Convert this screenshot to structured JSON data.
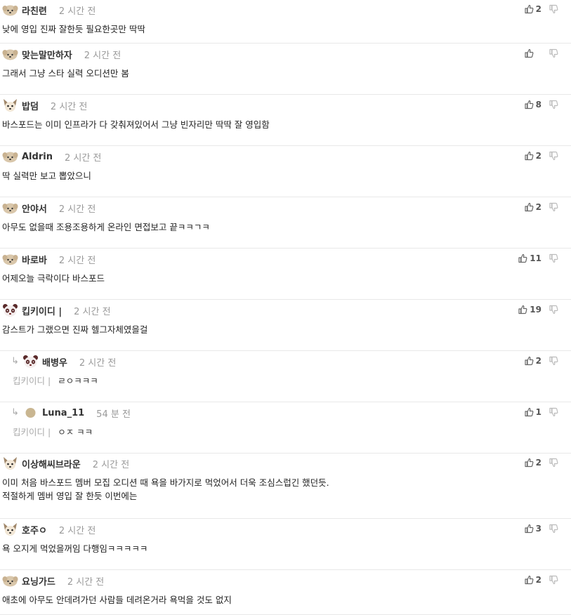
{
  "comments": [
    {
      "nick": "라친련",
      "time": "2 시간 전",
      "text": "낮에 영입 진짜 잘한듯 필요한곳만 딱딱",
      "votes": "2",
      "avatar": "pup"
    },
    {
      "nick": "맞는말만하자",
      "time": "2 시간 전",
      "text": "그래서 그냥 스타 실력 오디션만 봄",
      "votes": "",
      "avatar": "pup"
    },
    {
      "nick": "밥덤",
      "time": "2 시간 전",
      "text": "바스포드는 이미 인프라가 다 갖춰져있어서 그냥 빈자리만 딱딱 잘 영입함",
      "votes": "8",
      "avatar": "fox"
    },
    {
      "nick": "Aldrin",
      "time": "2 시간 전",
      "text": "딱 실력만 보고 뽑았으니",
      "votes": "2",
      "avatar": "pup"
    },
    {
      "nick": "안야서",
      "time": "2 시간 전",
      "text": "아무도 없을때 조용조용하게 온라인 면접보고 끝ㅋㅋㄱㅋ",
      "votes": "2",
      "avatar": "pup"
    },
    {
      "nick": "바로바",
      "time": "2 시간 전",
      "text": "어제오늘 극락이다 바스포드",
      "votes": "11",
      "avatar": "pup"
    },
    {
      "nick": "킵키이디 |",
      "time": "2 시간 전",
      "text": "감스트가 그랬으면 진짜 헬그자체였을걸",
      "votes": "19",
      "avatar": "panda"
    },
    {
      "nick": "배병우",
      "time": "2 시간 전",
      "mention": "킵키이디 |",
      "text": "ㄹㅇㅋㅋㅋ",
      "votes": "2",
      "avatar": "panda",
      "reply": true
    },
    {
      "nick": "Luna_11",
      "time": "54 분 전",
      "mention": "킵키이디 |",
      "text": "ㅇㅈ ㅋㅋ",
      "votes": "1",
      "avatar": "dot",
      "reply": true
    },
    {
      "nick": "이상해씨브라운",
      "time": "2 시간 전",
      "text": "이미 처음 바스포드 멤버 모집 오디션 때 욕을 바가지로 먹었어서 더욱 조심스럽긴 했던듯.\n적절하게 멤버 영입 잘 한듯 이번에는",
      "votes": "2",
      "avatar": "fox"
    },
    {
      "nick": "호주ㅇ",
      "time": "2 시간 전",
      "text": "욕 오지게 먹었을꺼임 다행임ㅋㅋㅋㅋㅋ",
      "votes": "3",
      "avatar": "fox"
    },
    {
      "nick": "요닝가드",
      "time": "2 시간 전",
      "text": "애초에 아무도 안데려가던 사람들 데려온거라 욕먹을 것도 없지",
      "votes": "2",
      "avatar": "pup"
    }
  ],
  "colors": {
    "nick": "#333333",
    "time": "#999999",
    "divider": "#e8e8e8",
    "icon": "#777777"
  },
  "icons": {
    "up": "thumbs-up-icon",
    "down": "thumbs-down-icon",
    "reply": "reply-arrow-icon"
  }
}
